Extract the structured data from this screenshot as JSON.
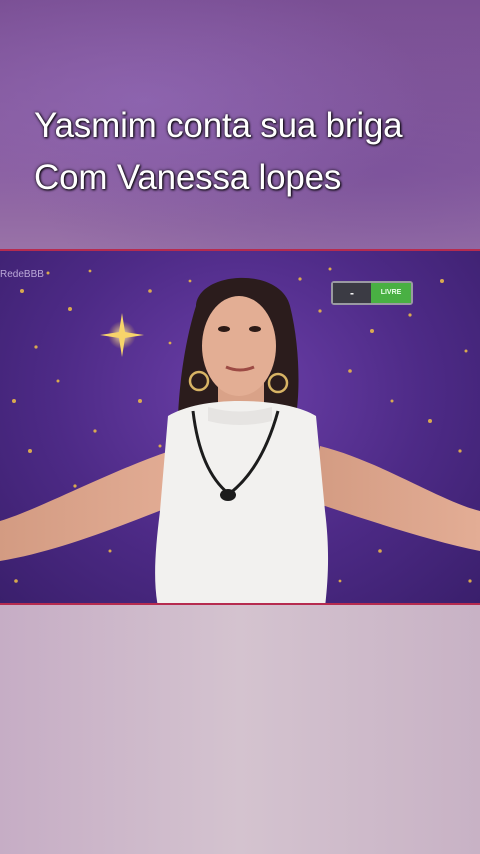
{
  "caption": {
    "line1": "Yasmim conta sua briga",
    "line2": "Com Vanessa lopes"
  },
  "video": {
    "watermark": "RedeBBB",
    "status_dash": "-",
    "status_label": "LIVRE"
  },
  "colors": {
    "video_border": "#b62b4f",
    "live_green": "#49b043",
    "starfield": "#4d2a86"
  }
}
